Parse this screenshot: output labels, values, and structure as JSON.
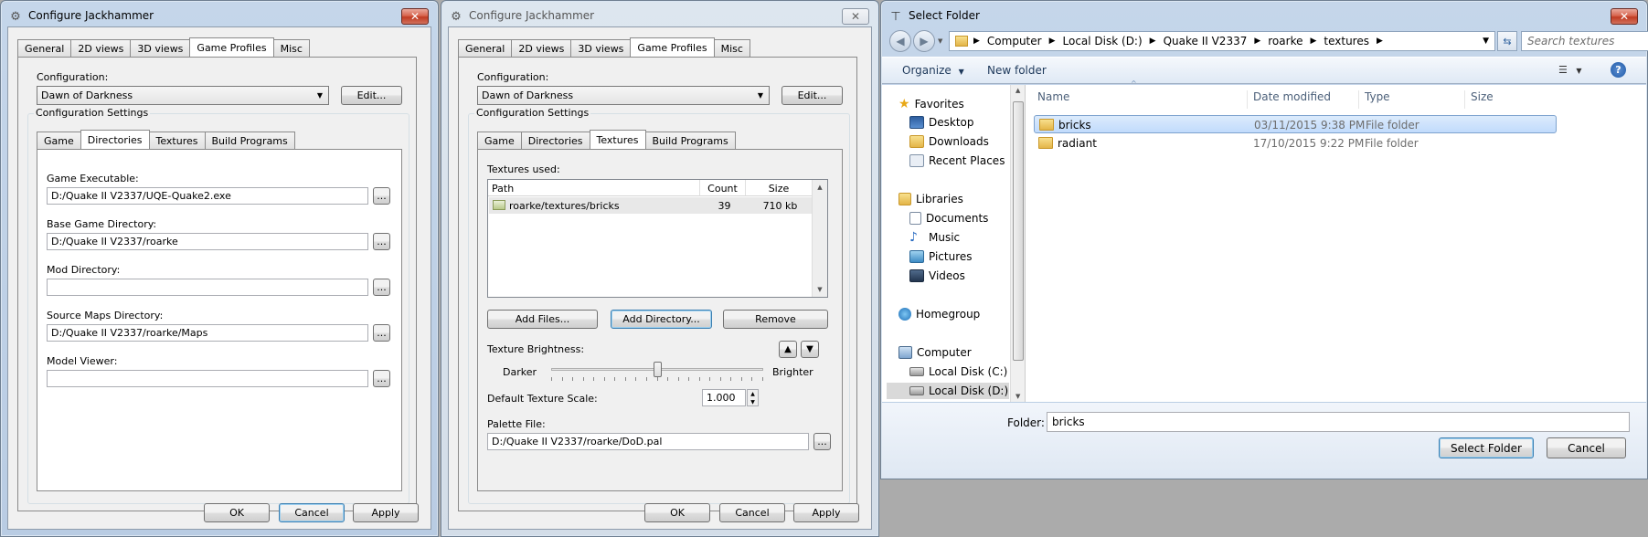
{
  "dialog1": {
    "title": "Configure Jackhammer",
    "tabs": [
      "General",
      "2D views",
      "3D views",
      "Game Profiles",
      "Misc"
    ],
    "active_tab": "Game Profiles",
    "configuration_label": "Configuration:",
    "configuration_value": "Dawn of Darkness",
    "edit_label": "Edit...",
    "settings_group": "Configuration Settings",
    "subtabs": [
      "Game",
      "Directories",
      "Textures",
      "Build Programs"
    ],
    "active_subtab": "Directories",
    "fields": [
      {
        "label": "Game Executable:",
        "value": "D:/Quake II V2337/UQE-Quake2.exe"
      },
      {
        "label": "Base Game Directory:",
        "value": "D:/Quake II V2337/roarke"
      },
      {
        "label": "Mod Directory:",
        "value": ""
      },
      {
        "label": "Source Maps Directory:",
        "value": "D:/Quake II V2337/roarke/Maps"
      },
      {
        "label": "Model Viewer:",
        "value": ""
      }
    ],
    "browse_label": "...",
    "ok_label": "OK",
    "cancel_label": "Cancel",
    "apply_label": "Apply"
  },
  "dialog2": {
    "title": "Configure Jackhammer",
    "tabs": [
      "General",
      "2D views",
      "3D views",
      "Game Profiles",
      "Misc"
    ],
    "configuration_label": "Configuration:",
    "configuration_value": "Dawn of Darkness",
    "edit_label": "Edit...",
    "settings_group": "Configuration Settings",
    "subtabs": [
      "Game",
      "Directories",
      "Textures",
      "Build Programs"
    ],
    "active_subtab": "Textures",
    "textures_used_label": "Textures used:",
    "columns": [
      "Path",
      "Count",
      "Size"
    ],
    "rows": [
      {
        "path": "roarke/textures/bricks",
        "count": "39",
        "size": "710 kb"
      }
    ],
    "add_files_label": "Add Files...",
    "add_directory_label": "Add Directory...",
    "remove_label": "Remove",
    "brightness_label": "Texture Brightness:",
    "darker_label": "Darker",
    "brighter_label": "Brighter",
    "brightness_level": 0.5,
    "scale_label": "Default Texture Scale:",
    "scale_value": "1.000",
    "palette_label": "Palette File:",
    "palette_value": "D:/Quake II V2337/roarke/DoD.pal",
    "browse_label": "...",
    "ok_label": "OK",
    "cancel_label": "Cancel",
    "apply_label": "Apply"
  },
  "folder_dialog": {
    "title": "Select Folder",
    "breadcrumb": [
      "Computer",
      "Local Disk (D:)",
      "Quake II V2337",
      "roarke",
      "textures"
    ],
    "search_placeholder": "Search textures",
    "organize_label": "Organize",
    "new_folder_label": "New folder",
    "nav": {
      "favorites": "Favorites",
      "favorites_items": [
        "Desktop",
        "Downloads",
        "Recent Places"
      ],
      "libraries": "Libraries",
      "libraries_items": [
        "Documents",
        "Music",
        "Pictures",
        "Videos"
      ],
      "homegroup": "Homegroup",
      "computer": "Computer",
      "computer_items": [
        "Local Disk (C:)",
        "Local Disk (D:)"
      ]
    },
    "columns": [
      "Name",
      "Date modified",
      "Type",
      "Size"
    ],
    "files": [
      {
        "name": "bricks",
        "date": "03/11/2015 9:38 PM",
        "type": "File folder"
      },
      {
        "name": "radiant",
        "date": "17/10/2015 9:22 PM",
        "type": "File folder"
      }
    ],
    "folder_label": "Folder:",
    "folder_value": "bricks",
    "select_label": "Select Folder",
    "cancel_label": "Cancel"
  },
  "colors": {
    "selection": "#c1dbfc",
    "title_active": "#c5d6ea",
    "close_red": "#c03b22"
  }
}
